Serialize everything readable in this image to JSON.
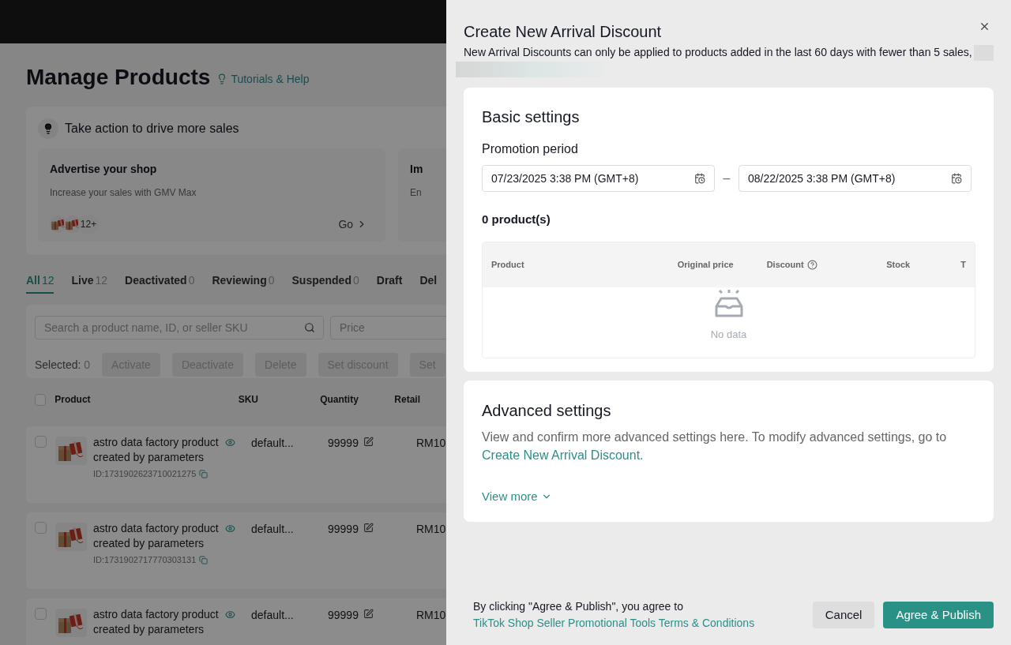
{
  "page": {
    "title": "Manage Products",
    "help_link": "Tutorials & Help",
    "action_panel": {
      "title": "Take action to drive more sales",
      "cards": [
        {
          "title": "Advertise your shop",
          "description": "Increase your sales with GMV Max",
          "count": "12+",
          "link": "Go"
        },
        {
          "title": "Im",
          "description": "En"
        }
      ]
    },
    "tabs": [
      {
        "label": "All",
        "count": "12",
        "selected": true
      },
      {
        "label": "Live",
        "count": "12",
        "selected": false
      },
      {
        "label": "Deactivated",
        "count": "0",
        "selected": false
      },
      {
        "label": "Reviewing",
        "count": "0",
        "selected": false
      },
      {
        "label": "Suspended",
        "count": "0",
        "selected": false
      },
      {
        "label": "Draft",
        "selected": false
      },
      {
        "label": "Del",
        "selected": false
      }
    ],
    "search": {
      "placeholder": "Search a product name, ID, or seller SKU"
    },
    "price_filter": {
      "placeholder": "Price"
    },
    "selected_label": "Selected:",
    "selected_count": "0",
    "bulk_actions": [
      "Activate",
      "Deactivate",
      "Delete",
      "Set discount",
      "Set"
    ],
    "table": {
      "select_all_checked": false,
      "columns": [
        "Product",
        "SKU",
        "Quantity",
        "Retail"
      ],
      "rows": [
        {
          "name": "astro data factory product created by parameters",
          "id": "ID:1731902623710021275",
          "sku": "default...",
          "quantity": "99999",
          "price": "RM10",
          "checked": false
        },
        {
          "name": "astro data factory product created by parameters",
          "id": "ID:1731902717770303131",
          "sku": "default...",
          "quantity": "99999",
          "price": "RM10",
          "checked": false
        },
        {
          "name": "astro data factory product created by parameters",
          "sku": "default...",
          "quantity": "99999",
          "price": "RM10",
          "checked": false
        }
      ]
    }
  },
  "drawer": {
    "title": "Create New Arrival Discount",
    "description": "New Arrival Discounts can only be applied to products added in the last 60 days with fewer than 5 sales,",
    "basic": {
      "title": "Basic settings",
      "period_label": "Promotion period",
      "start": "07/23/2025 3:38 PM (GMT+8)",
      "separator": "–",
      "end": "08/22/2025 3:38 PM (GMT+8)",
      "count": "0 product(s)",
      "columns": [
        "Product",
        "Original price",
        "Discount",
        "Stock",
        "T"
      ],
      "empty": "No data"
    },
    "advanced": {
      "title": "Advanced settings",
      "text": "View and confirm more advanced settings here. To modify advanced settings, go to",
      "link": "Create New Arrival Discount.",
      "more": "View more"
    },
    "footer": {
      "text": "By clicking \"Agree & Publish\", you agree to",
      "link": "TikTok Shop Seller Promotional Tools Terms & Conditions",
      "buttons": [
        {
          "label": "Cancel",
          "kind": "secondary"
        },
        {
          "label": "Agree & Publish",
          "kind": "primary"
        }
      ]
    }
  }
}
